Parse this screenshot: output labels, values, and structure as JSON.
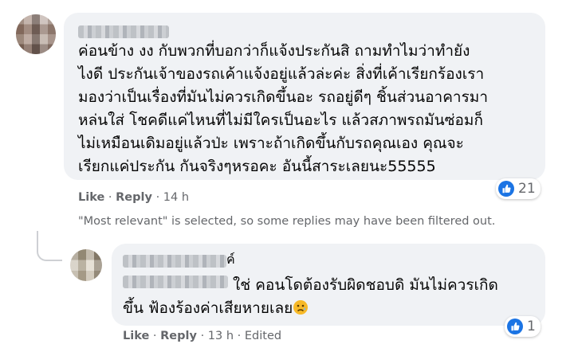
{
  "comment": {
    "text_lines": [
      "ค่อนข้าง งง กับพวกที่บอกว่าก็แจ้งประกันสิ ถามทำไมว่าทำยัง",
      "ไงดี ประกันเจ้าของรถเค้าแจ้งอยู่แล้วล่ะค่ะ สิ่งที่เค้าเรียกร้องเรา",
      "มองว่าเป็นเรื่องที่มันไม่ควรเกิดขึ้นอะ รถอยู่ดีๆ ชิ้นส่วนอาคารมา",
      "หล่นใส่ โชคดีแค่ไหนที่ไม่มีใครเป็นอะไร แล้วสภาพรถมันซ่อมก็",
      "ไม่เหมือนเดิมอยู่แล้วป่ะ เพราะถ้าเกิดขึ้นกับรถคุณเอง คุณจะ",
      "เรียกแค่ประกัน กันจริงๆหรอคะ อันนี้สาระเลยนะ55555"
    ],
    "like_label": "Like",
    "reply_label": "Reply",
    "time": "14 h",
    "reaction_count": "21"
  },
  "filter_note": "\"Most relevant\" is selected, so some replies may have been filtered out.",
  "reply": {
    "name_tail": "ค์",
    "line1_text": "ใช่ คอนโดต้องรับผิดชอบดิ มันไม่ควรเกิด",
    "line2_text": "ขึ้น ฟ้องร้องค่าเสียหายเลย",
    "emoji": "sad-face-emoji",
    "like_label": "Like",
    "reply_label": "Reply",
    "time": "13 h",
    "edited_label": "Edited",
    "reaction_count": "1"
  },
  "colors": {
    "bubble": "#f0f2f5",
    "meta": "#65676b",
    "like_blue": "#1b74e4"
  }
}
